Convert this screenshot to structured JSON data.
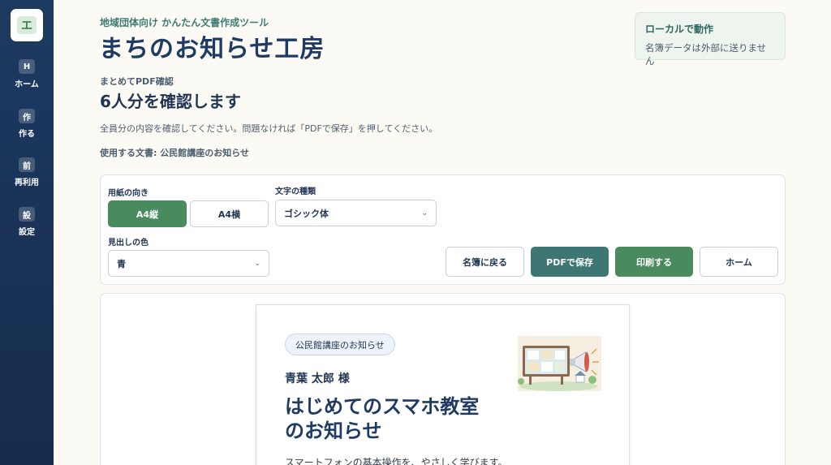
{
  "sidebar": {
    "logo": "エ",
    "items": [
      {
        "badge": "H",
        "label": "ホーム"
      },
      {
        "badge": "作",
        "label": "作る"
      },
      {
        "badge": "前",
        "label": "再利用"
      },
      {
        "badge": "設",
        "label": "設定"
      }
    ]
  },
  "header": {
    "eyebrow": "地域団体向け かんたん文書作成ツール",
    "title": "まちのお知らせ工房",
    "local_title": "ローカルで動作",
    "local_sub": "名簿データは外部に送りません"
  },
  "section": {
    "label": "まとめてPDF確認",
    "title": "6人分を確認します",
    "description": "全員分の内容を確認してください。問題なければ「PDFで保存」を押してください。",
    "doc_used": "使用する文書: 公民館講座のお知らせ"
  },
  "options": {
    "orientation_label": "用紙の向き",
    "portrait_label": "A4縦",
    "landscape_label": "A4横",
    "font_label": "文字の種類",
    "font_value": "ゴシック体",
    "heading_color_label": "見出しの色",
    "heading_color_value": "青",
    "back_button": "名簿に戻る",
    "pdf_button": "PDFで保存",
    "print_button": "印刷する",
    "home_button": "ホーム"
  },
  "preview": {
    "category": "公民館講座のお知らせ",
    "recipient": "青葉 太郎 様",
    "title_line1": "はじめてのスマホ教室",
    "title_line2": "のお知らせ",
    "body": "スマートフォンの基本操作を、やさしく学びます。"
  }
}
